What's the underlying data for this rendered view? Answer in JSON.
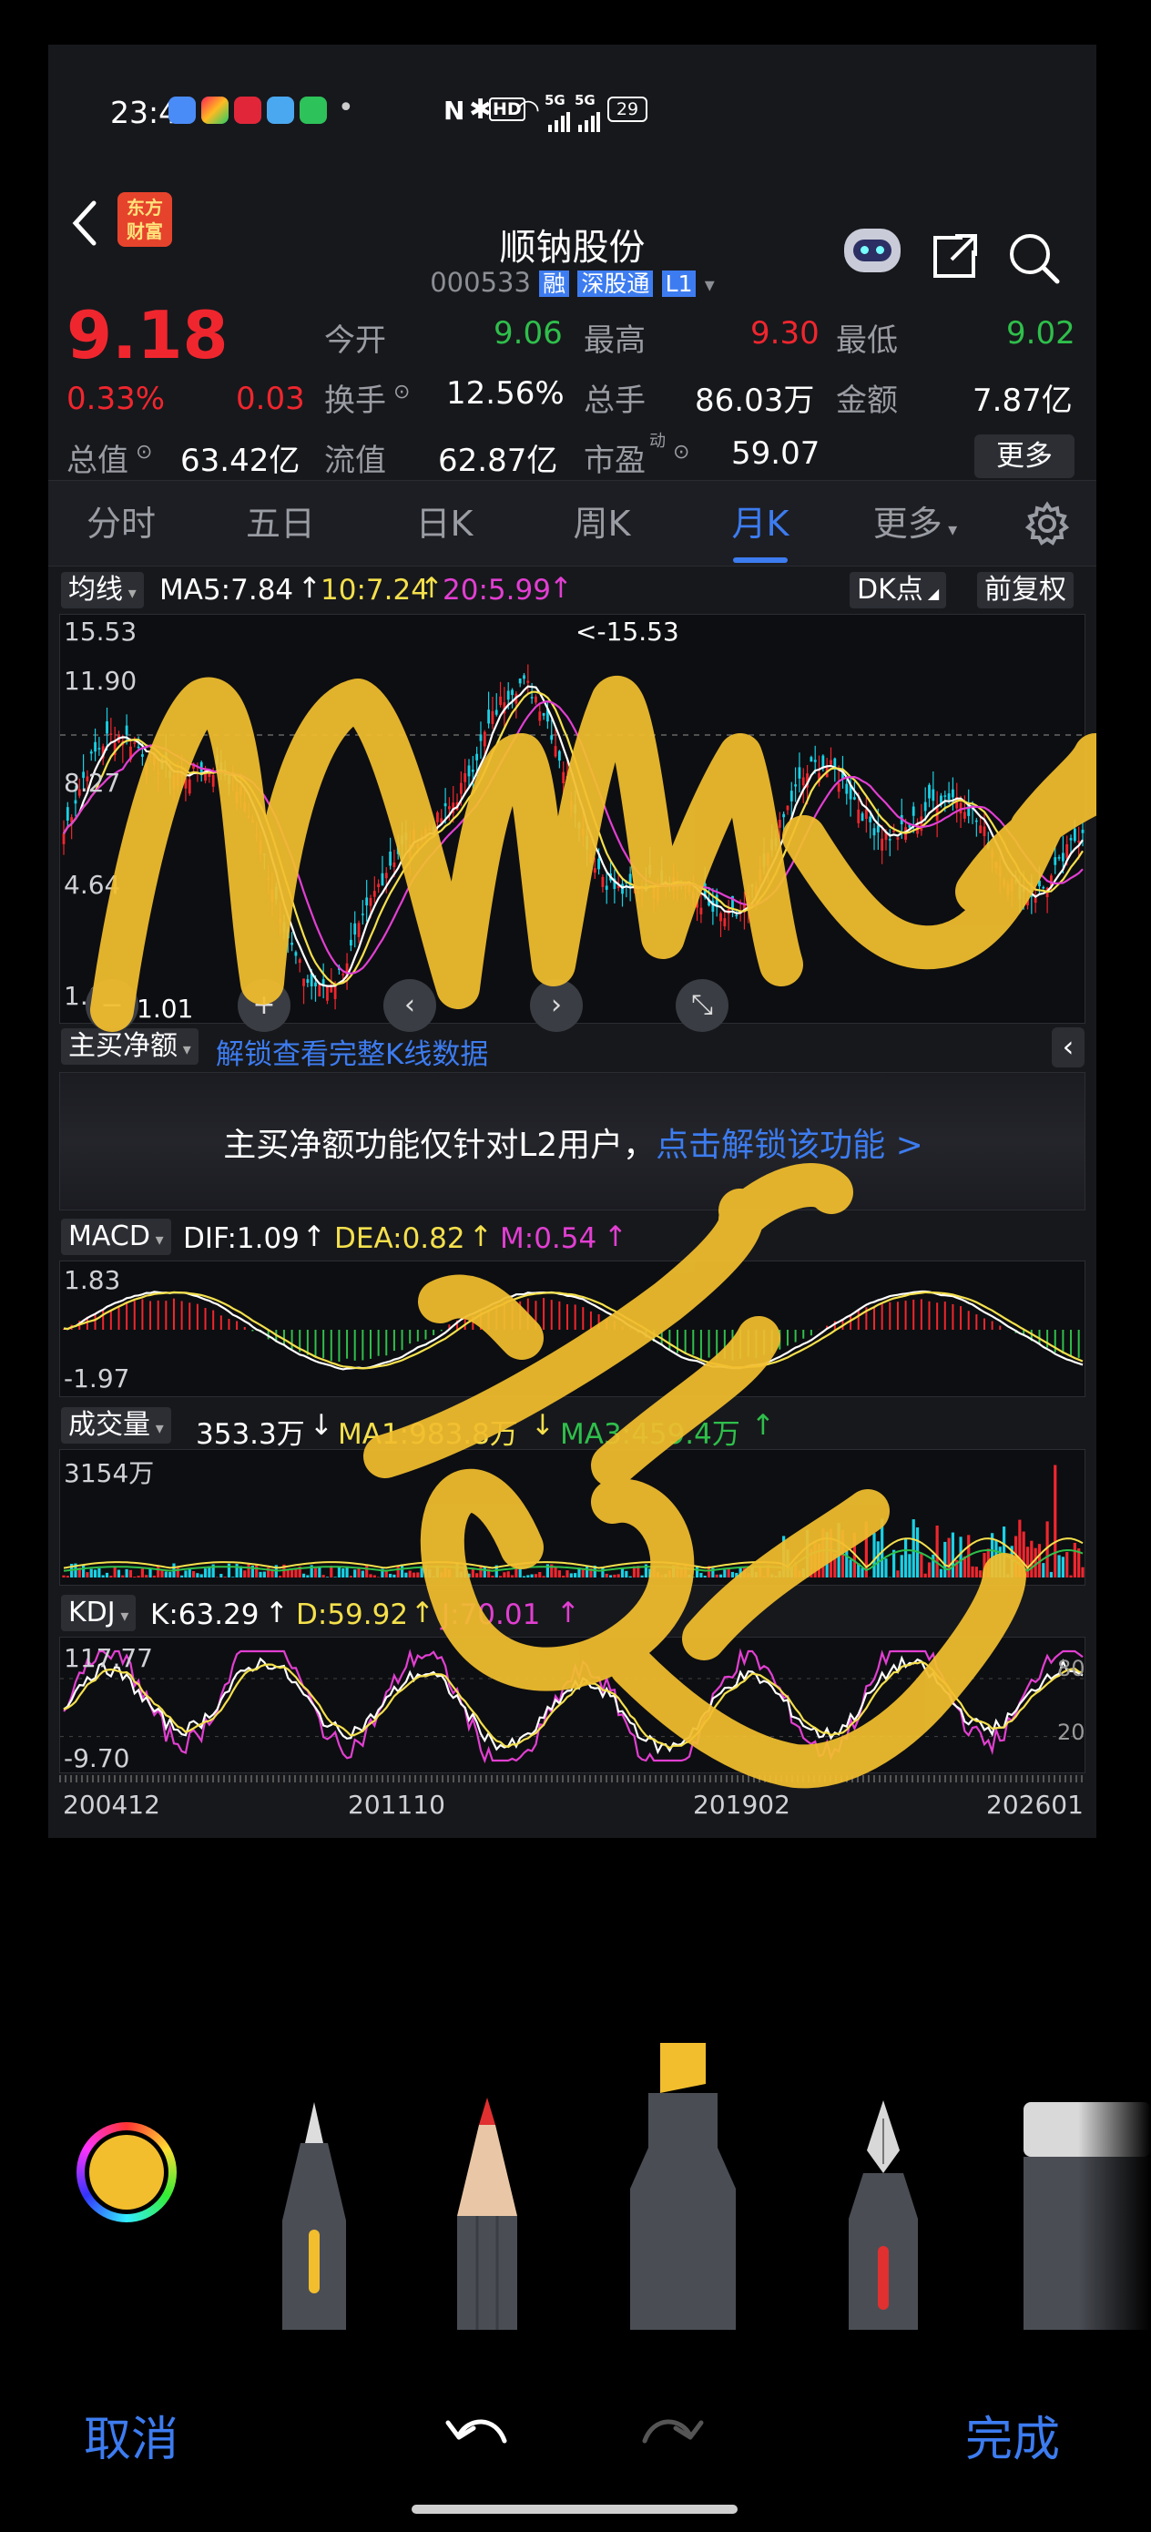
{
  "status_bar": {
    "time": "23:46",
    "dot": "•",
    "hd_label": "HD",
    "net_label1": "5G",
    "net_label2": "5G",
    "battery": "29"
  },
  "header": {
    "title": "顺钠股份",
    "code": "000533",
    "badge_rong": "融",
    "badge_sgt": "深股通",
    "badge_level": "L1",
    "logo_line1": "东方",
    "logo_line2": "财富"
  },
  "quote": {
    "price": "9.18",
    "change_pct": "0.33%",
    "change": "0.03",
    "open_label": "今开",
    "open": "9.06",
    "high_label": "最高",
    "high": "9.30",
    "low_label": "最低",
    "low": "9.02",
    "turnover_label": "换手",
    "turnover": "12.56%",
    "volume_label": "总手",
    "volume": "86.03万",
    "amount_label": "金额",
    "amount": "7.87亿",
    "mcap_label": "总值",
    "mcap": "63.42亿",
    "float_label": "流值",
    "float": "62.87亿",
    "pe_label": "市盈",
    "pe_sup": "动",
    "pe": "59.07",
    "more_button": "更多"
  },
  "tabs": [
    "分时",
    "五日",
    "日K",
    "周K",
    "月K",
    "更多"
  ],
  "active_tab": 4,
  "kline": {
    "indicator": "均线",
    "ma5": "MA5:7.84",
    "ma10": "10:7.24",
    "ma20": "20:5.99",
    "dk_button": "DK点",
    "adjust_button": "前复权",
    "y_ticks": [
      "15.53",
      "11.90",
      "8.27",
      "4.64",
      "1.01"
    ],
    "max_label": "<-15.53",
    "min_label": "1.01"
  },
  "main_buy": {
    "dropdown": "主买净额",
    "unlock_link": "解锁查看完整K线数据",
    "notice": "主买净额功能仅针对L2用户，",
    "notice_link": "点击解锁该功能 >"
  },
  "macd": {
    "dropdown": "MACD",
    "dif": "DIF:1.09",
    "dea": "DEA:0.82",
    "m": "M:0.54",
    "y_top": "1.83",
    "y_bottom": "-1.97"
  },
  "volume_panel": {
    "dropdown": "成交量",
    "vol": "353.3万",
    "ma1": "MA1:983.8万",
    "ma3": "MA3:459.4万",
    "y_top": "3154万"
  },
  "kdj": {
    "dropdown": "KDJ",
    "k": "K:63.29",
    "d": "D:59.92",
    "j": "J:70.01",
    "y_top": "117.77",
    "y_bottom": "-9.70",
    "ref_80": "80",
    "ref_20": "20"
  },
  "x_axis": [
    "200412",
    "201110",
    "201902",
    "202601"
  ],
  "markup_toolbar": {
    "cancel": "取消",
    "done": "完成",
    "pen_color": "#f2be2e"
  },
  "colors": {
    "up": "#f0262e",
    "down": "#2fbf4b",
    "accent": "#3d7cf0",
    "ma_white": "#ffffff",
    "ma_yellow": "#f5e04c",
    "ma_magenta": "#e23fd2",
    "cyan": "#19d1e6",
    "ink": "#f2be2e"
  }
}
